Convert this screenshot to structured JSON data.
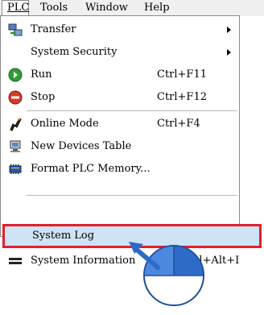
{
  "menubar": {
    "items": [
      {
        "label": "PLC",
        "mnemonic": "P",
        "active": true
      },
      {
        "label": "Tools",
        "mnemonic": "T"
      },
      {
        "label": "Window",
        "mnemonic": "W"
      },
      {
        "label": "Help",
        "mnemonic": "H"
      }
    ]
  },
  "menu": {
    "items": [
      {
        "label": "Transfer",
        "shortcut": "",
        "submenu": true,
        "icon": "transfer-icon"
      },
      {
        "label": "System Security",
        "shortcut": "",
        "submenu": true,
        "icon": ""
      },
      {
        "label": "Run",
        "shortcut": "Ctrl+F11",
        "icon": "run-icon"
      },
      {
        "label": "Stop",
        "shortcut": "Ctrl+F12",
        "icon": "stop-icon"
      },
      {
        "label": "Online Mode",
        "shortcut": "Ctrl+F4",
        "icon": "online-mode-icon"
      },
      {
        "label": "New Devices Table",
        "shortcut": "",
        "icon": "devices-table-icon"
      },
      {
        "label": "Format PLC Memory...",
        "shortcut": "",
        "icon": "format-memory-icon"
      },
      {
        "label": "System Log",
        "shortcut": "",
        "icon": "",
        "highlighted": true
      },
      {
        "label": "System Information",
        "shortcut": "Ctrl+Alt+I",
        "icon": "system-info-icon"
      }
    ]
  },
  "colors": {
    "highlight_border": "#e3202a",
    "highlight_fill": "#cfe3f7",
    "cursor_blue": "#1f6fcf"
  }
}
